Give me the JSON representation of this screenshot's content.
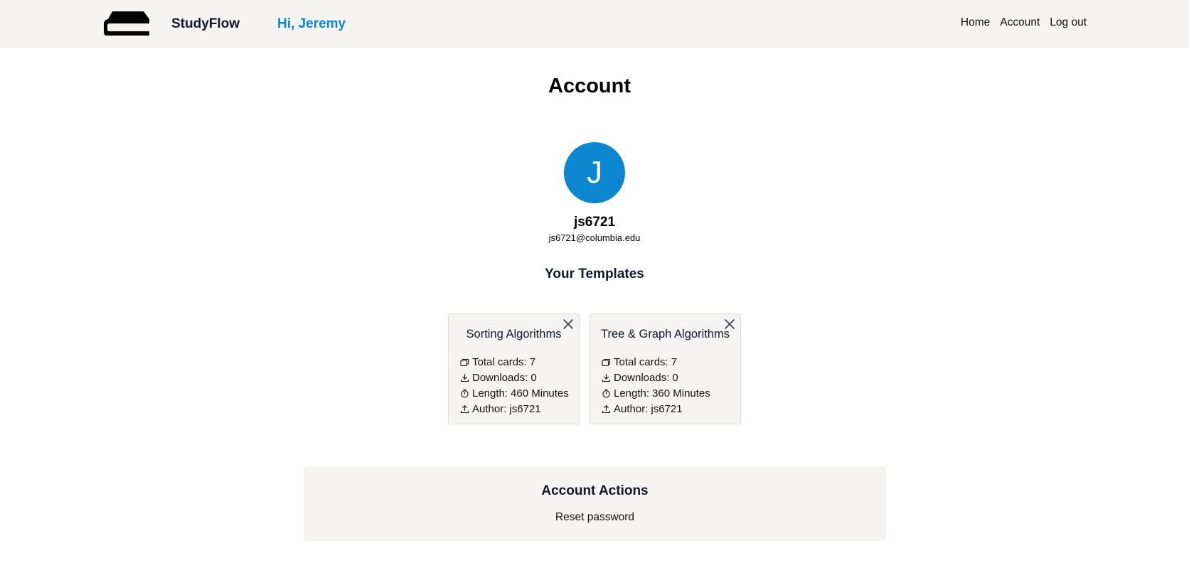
{
  "header": {
    "brand": "StudyFlow",
    "greeting": "Hi, Jeremy",
    "nav": [
      "Home",
      "Account",
      "Log out"
    ]
  },
  "page": {
    "title": "Account"
  },
  "profile": {
    "avatar_letter": "J",
    "username": "js6721",
    "email": "js6721@columbia.edu",
    "avatar_color": "#0b86cf"
  },
  "templates": {
    "section_title": "Your Templates",
    "items": [
      {
        "title": "Sorting Algorithms",
        "total_cards_label": "Total cards:",
        "total_cards": "7",
        "downloads_label": "Downloads:",
        "downloads": "0",
        "length_label": "Length:",
        "length": "460 Minutes",
        "author_label": "Author:",
        "author": "js6721"
      },
      {
        "title": "Tree & Graph Algorithms",
        "total_cards_label": "Total cards:",
        "total_cards": "7",
        "downloads_label": "Downloads:",
        "downloads": "0",
        "length_label": "Length:",
        "length": "360 Minutes",
        "author_label": "Author:",
        "author": "js6721"
      }
    ]
  },
  "actions": {
    "title": "Account Actions",
    "reset_password": "Reset password"
  },
  "icons": {
    "logo": "card-stack-logo",
    "close": "close-icon",
    "total_cards": "cards-icon",
    "downloads": "download-icon",
    "length": "stopwatch-icon",
    "author": "upload-icon"
  }
}
